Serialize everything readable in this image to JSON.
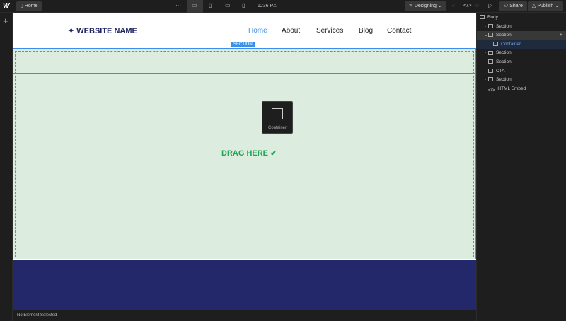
{
  "topbar": {
    "logo": "W",
    "page": "Home",
    "more": "···",
    "width": "1236 PX",
    "mode": "Designing",
    "share": "Share",
    "publish": "Publish"
  },
  "site": {
    "brand": "WEBSITE NAME",
    "nav": [
      "Home",
      "About",
      "Services",
      "Blog",
      "Contact"
    ],
    "section_tag": "SECTION",
    "container_label": "Container",
    "drag": "DRAG HERE"
  },
  "navigator": [
    {
      "label": "Body",
      "indent": 0
    },
    {
      "label": "Section",
      "indent": 1
    },
    {
      "label": "Section",
      "indent": 1,
      "selected": true
    },
    {
      "label": "Container",
      "indent": 2,
      "active": true
    },
    {
      "label": "Section",
      "indent": 1
    },
    {
      "label": "Section",
      "indent": 1
    },
    {
      "label": "CTA",
      "indent": 1
    },
    {
      "label": "Section",
      "indent": 1
    },
    {
      "label": "HTML Embed",
      "indent": 1
    }
  ],
  "status": "No Element Selected",
  "colors": {
    "accent": "#3b8fe8",
    "green": "#1fa555",
    "navy": "#22286a"
  }
}
